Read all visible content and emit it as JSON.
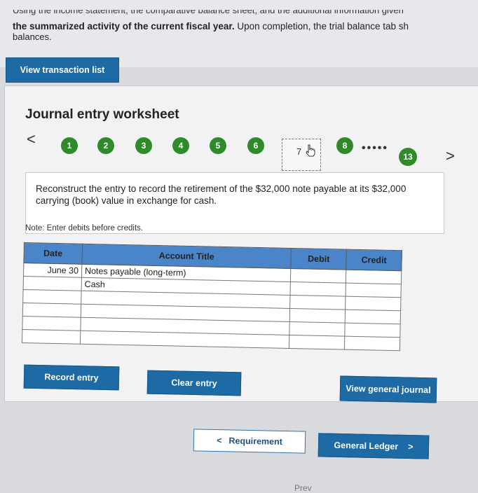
{
  "instructions": {
    "line1": "Using the income statement, the comparative balance sheet, and the additional information given",
    "line2_bold": "the summarized activity of the current fiscal year.",
    "line2_rest": " Upon completion, the trial balance tab sh",
    "line3": "balances."
  },
  "buttons": {
    "view_transaction_list": "View transaction list",
    "record_entry": "Record entry",
    "clear_entry": "Clear entry",
    "view_general_journal": "View general journal",
    "requirement": "Requirement",
    "requirement_arrow": "<",
    "general_ledger": "General Ledger",
    "general_ledger_arrow": ">"
  },
  "worksheet": {
    "title": "Journal entry worksheet",
    "prev_arrow": "<",
    "next_arrow": ">",
    "steps": [
      "1",
      "2",
      "3",
      "4",
      "5",
      "6",
      "7",
      "8",
      "13"
    ],
    "current_step": "7",
    "ellipsis": "•••••",
    "description": "Reconstruct the entry to record the retirement of the $32,000 note payable at its $32,000 carrying (book) value in exchange for cash.",
    "note": "Note: Enter debits before credits."
  },
  "table": {
    "headers": {
      "date": "Date",
      "account": "Account Title",
      "debit": "Debit",
      "credit": "Credit"
    },
    "rows": [
      {
        "date": "June 30",
        "account": "Notes payable (long-term)",
        "debit": "",
        "credit": ""
      },
      {
        "date": "",
        "account": "Cash",
        "debit": "",
        "credit": ""
      },
      {
        "date": "",
        "account": "",
        "debit": "",
        "credit": ""
      },
      {
        "date": "",
        "account": "",
        "debit": "",
        "credit": ""
      },
      {
        "date": "",
        "account": "",
        "debit": "",
        "credit": ""
      },
      {
        "date": "",
        "account": "",
        "debit": "",
        "credit": ""
      }
    ]
  },
  "footer": {
    "partial_text": "Prev"
  },
  "colors": {
    "step_green": "#2f8a2a",
    "button_blue": "#1d6aa5",
    "header_blue": "#4a85c9"
  }
}
